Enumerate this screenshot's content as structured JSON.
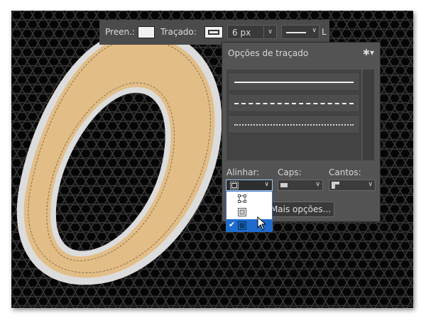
{
  "options_bar": {
    "fill_label": "Preen.:",
    "stroke_label": "Traçado:",
    "stroke_width": "6 px",
    "trailing_label": "L"
  },
  "stroke_options_panel": {
    "title": "Opções de traçado",
    "presets": [
      "solid",
      "dashed",
      "dotted"
    ],
    "align_label": "Alinhar:",
    "caps_label": "Caps:",
    "corners_label": "Cantos:",
    "more_options_label": "Mais opções..."
  },
  "align_dropdown": {
    "options": [
      "inside",
      "center",
      "outside"
    ],
    "selected": "outside",
    "check_glyph": "✔"
  },
  "canvas": {
    "letter": "0",
    "letter_fill": "#e2bd86",
    "stroke_color": "#dcdcdc"
  },
  "colors": {
    "panel_bg": "#535353",
    "selection": "#1d6ccd"
  }
}
